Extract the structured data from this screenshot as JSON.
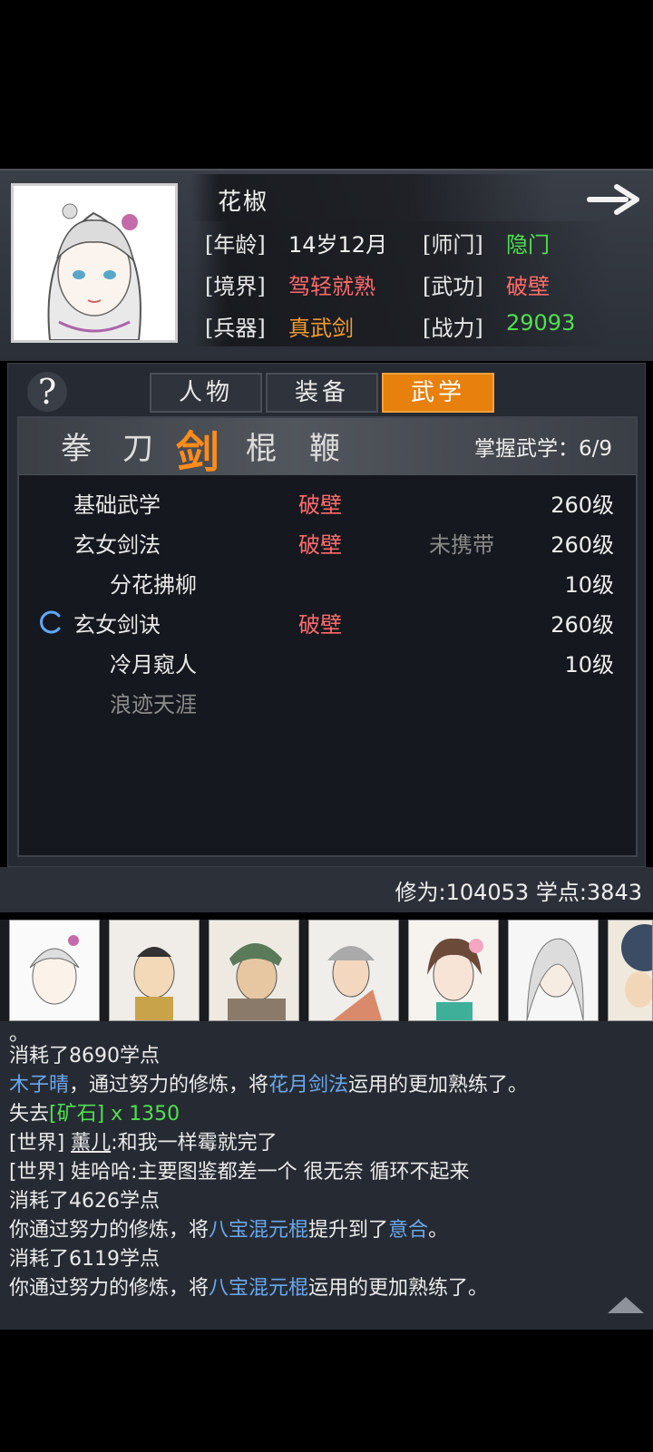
{
  "character": {
    "name": "花椒",
    "age_label": "[年龄]",
    "age": "14岁12月",
    "sect_label": "[师门]",
    "sect": "隐门",
    "realm_label": "[境界]",
    "realm": "驾轻就熟",
    "martial_label": "[武功]",
    "martial": "破壁",
    "weapon_label": "[兵器]",
    "weapon": "真武剑",
    "power_label": "[战力]",
    "power": "29093"
  },
  "tabs": [
    "人物",
    "装备",
    "武学"
  ],
  "active_tab": "武学",
  "weapon_types": [
    "拳",
    "刀",
    "剑",
    "棍",
    "鞭"
  ],
  "active_weapon_type": "剑",
  "mastery": "掌握武学：6/9",
  "skills": [
    {
      "name": "基础武学",
      "realm": "破壁",
      "carry": "",
      "level": "260级"
    },
    {
      "name": "玄女剑法",
      "realm": "破壁",
      "carry": "未携带",
      "level": "260级"
    },
    {
      "name": "分花拂柳",
      "realm": "",
      "carry": "",
      "level": "10级"
    },
    {
      "name": "玄女剑诀",
      "realm": "破壁",
      "carry": "",
      "level": "260级"
    },
    {
      "name": "冷月窥人",
      "realm": "",
      "carry": "",
      "level": "10级"
    },
    {
      "name": "浪迹天涯",
      "realm": "",
      "carry": "",
      "level": ""
    }
  ],
  "stats": "修为:104053 学点:3843",
  "log": {
    "l0": "。",
    "l1": "消耗了8690学点",
    "l2a": "木子晴",
    "l2b": "，通过努力的修炼，将",
    "l2c": "花月剑法",
    "l2d": "运用的更加熟练了。",
    "l3a": "失去",
    "l3b": "[矿石] x 1350",
    "l4a": "[世界] ",
    "l4b": "薰儿",
    "l4c": ":和我一样霉就完了",
    "l5": "[世界] 娃哈哈:主要图鉴都差一个 很无奈 循环不起来",
    "l6": "消耗了4626学点",
    "l7a": "你通过努力的修炼，将",
    "l7b": "八宝混元棍",
    "l7c": "提升到了",
    "l7d": "意合",
    "l7e": "。",
    "l8": "消耗了6119学点",
    "l9a": "你通过努力的修炼，将",
    "l9b": "八宝混元棍",
    "l9c": "运用的更加熟练了。"
  }
}
